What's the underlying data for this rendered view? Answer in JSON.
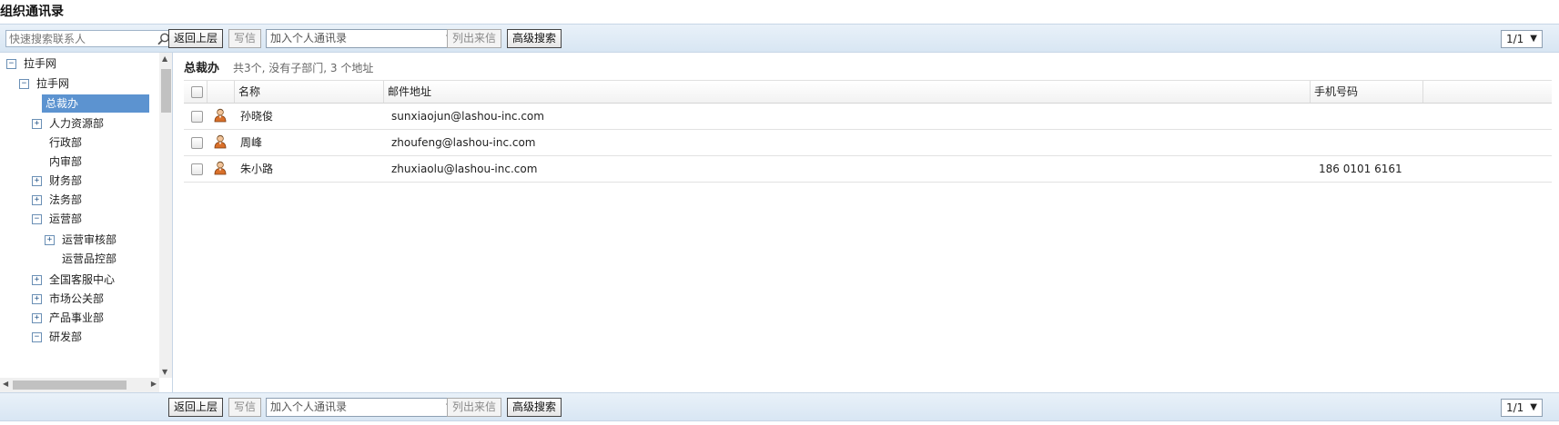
{
  "page_title": "组织通讯录",
  "search": {
    "placeholder": "快速搜索联系人"
  },
  "toolbar": {
    "back_label": "返回上层",
    "write_label": "写信",
    "add_personal_label": "加入个人通讯录",
    "list_letters_label": "列出来信",
    "advanced_search_label": "高级搜索",
    "page_indicator": "1/1"
  },
  "tree": {
    "root": "拉手网",
    "child": "拉手网",
    "items": [
      {
        "label": "总裁办",
        "expander": "",
        "selected": true
      },
      {
        "label": "人力资源部",
        "expander": "+"
      },
      {
        "label": "行政部",
        "expander": ""
      },
      {
        "label": "内审部",
        "expander": ""
      },
      {
        "label": "财务部",
        "expander": "+"
      },
      {
        "label": "法务部",
        "expander": "+"
      },
      {
        "label": "运营部",
        "expander": "−"
      },
      {
        "label": "运营审核部",
        "expander": "+"
      },
      {
        "label": "运营品控部",
        "expander": ""
      },
      {
        "label": "全国客服中心",
        "expander": "+"
      },
      {
        "label": "市场公关部",
        "expander": "+"
      },
      {
        "label": "产品事业部",
        "expander": "+"
      },
      {
        "label": "研发部",
        "expander": "−"
      }
    ]
  },
  "main": {
    "dept_title": "总裁办",
    "dept_info": "共3个, 没有子部门, 3 个地址",
    "columns": {
      "name": "名称",
      "email": "邮件地址",
      "phone": "手机号码"
    },
    "rows": [
      {
        "name": "孙晓俊",
        "email": "sunxiaojun@lashou-inc.com",
        "phone": ""
      },
      {
        "name": "周峰",
        "email": "zhoufeng@lashou-inc.com",
        "phone": ""
      },
      {
        "name": "朱小路",
        "email": "zhuxiaolu@lashou-inc.com",
        "phone": "186 0101 6161"
      }
    ]
  },
  "colors": {
    "toolbar_bg": "#dde9f5",
    "selected_bg": "#5c93d0",
    "border": "#c7d6e6"
  },
  "icons": {
    "search": "search-icon",
    "contact": "person-icon"
  }
}
